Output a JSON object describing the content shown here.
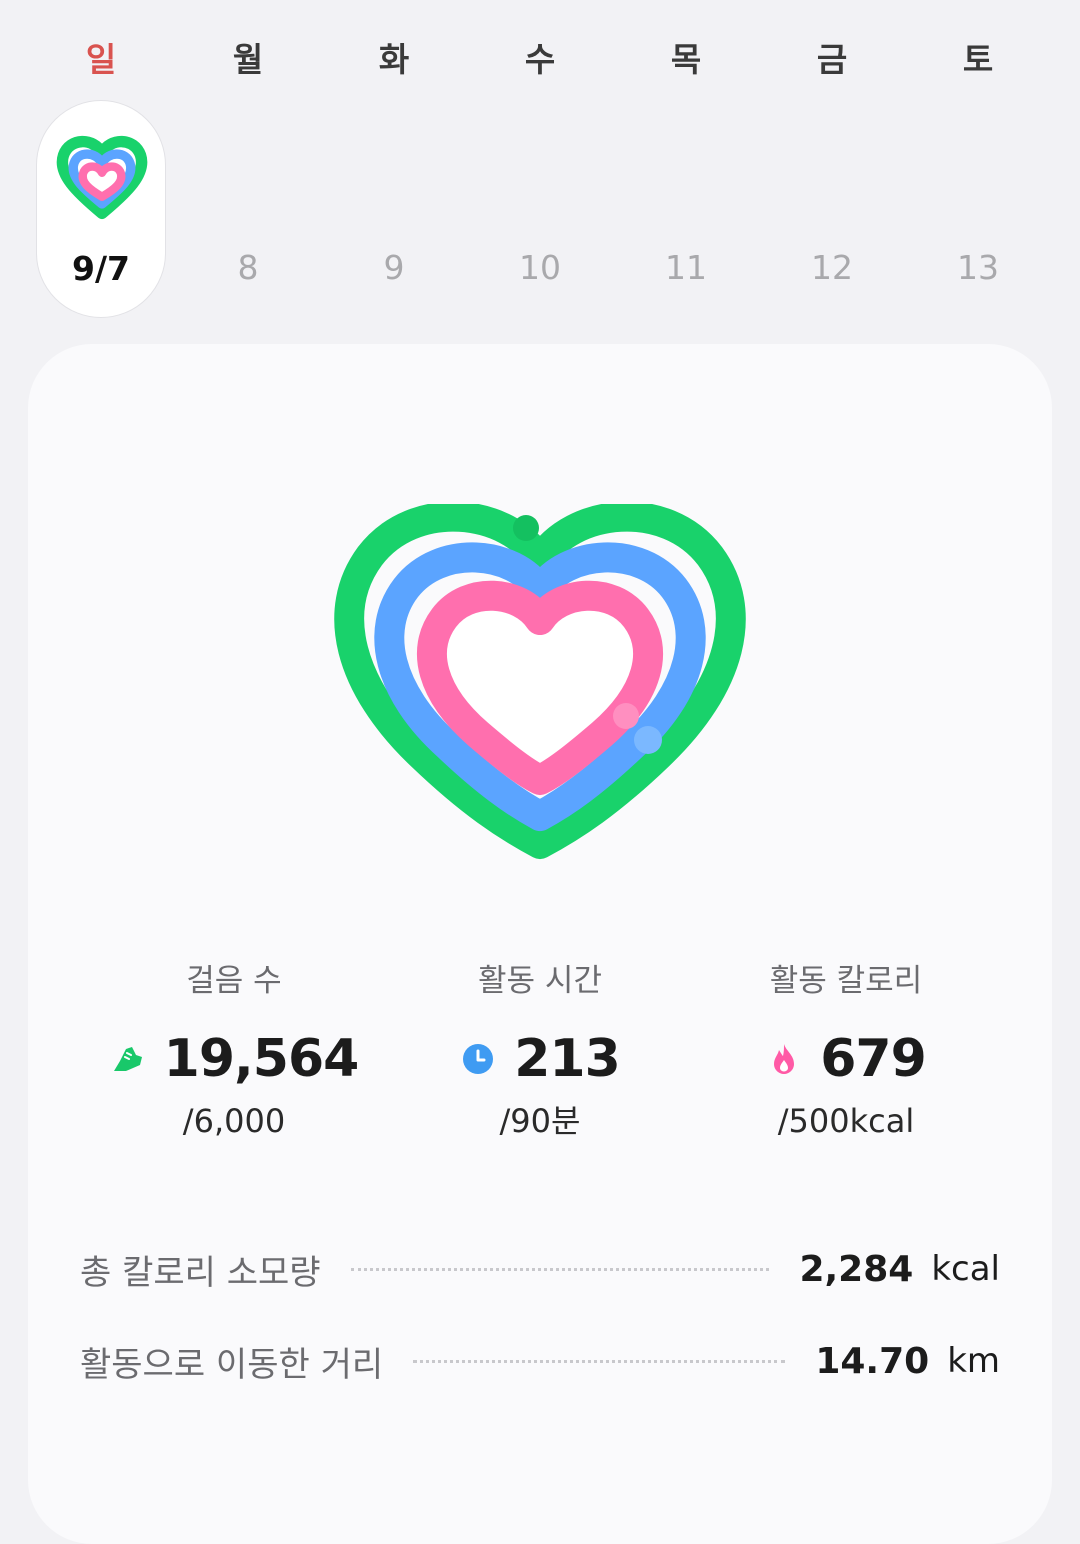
{
  "week": {
    "weekdays": [
      "일",
      "월",
      "화",
      "수",
      "목",
      "금",
      "토"
    ],
    "dates": [
      "9/7",
      "8",
      "9",
      "10",
      "11",
      "12",
      "13"
    ],
    "selected_index": 0
  },
  "activity": {
    "rings": [
      {
        "name": "steps",
        "color": "#19d26b",
        "progress": 1.0
      },
      {
        "name": "active_time",
        "color": "#5ba4ff",
        "progress": 1.0
      },
      {
        "name": "calories",
        "color": "#ff6fae",
        "progress": 1.0
      }
    ]
  },
  "stats": [
    {
      "label": "걸음 수",
      "icon": "shoe-icon",
      "color": "#19c86a",
      "value": "19,564",
      "goal": "/6,000"
    },
    {
      "label": "활동 시간",
      "icon": "clock-icon",
      "color": "#3f9bf2",
      "value": "213",
      "goal": "/90분"
    },
    {
      "label": "활동 칼로리",
      "icon": "flame-icon",
      "color": "#ff5aa6",
      "value": "679",
      "goal": "/500kcal"
    }
  ],
  "summary": [
    {
      "label": "총 칼로리 소모량",
      "value": "2,284",
      "unit": "kcal"
    },
    {
      "label": "활동으로 이동한 거리",
      "value": "14.70",
      "unit": "km"
    }
  ]
}
